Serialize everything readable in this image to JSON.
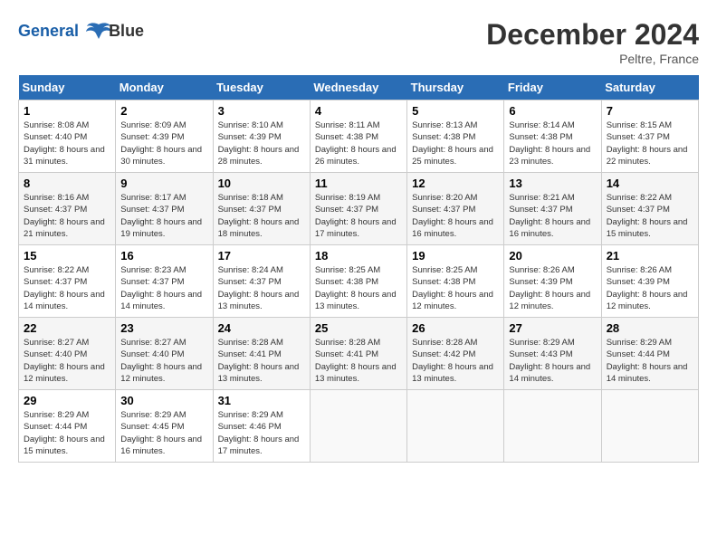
{
  "header": {
    "logo_line1": "General",
    "logo_line2": "Blue",
    "month": "December 2024",
    "location": "Peltre, France"
  },
  "days_of_week": [
    "Sunday",
    "Monday",
    "Tuesday",
    "Wednesday",
    "Thursday",
    "Friday",
    "Saturday"
  ],
  "weeks": [
    [
      {
        "day": "1",
        "sunrise": "8:08 AM",
        "sunset": "4:40 PM",
        "daylight": "8 hours and 31 minutes."
      },
      {
        "day": "2",
        "sunrise": "8:09 AM",
        "sunset": "4:39 PM",
        "daylight": "8 hours and 30 minutes."
      },
      {
        "day": "3",
        "sunrise": "8:10 AM",
        "sunset": "4:39 PM",
        "daylight": "8 hours and 28 minutes."
      },
      {
        "day": "4",
        "sunrise": "8:11 AM",
        "sunset": "4:38 PM",
        "daylight": "8 hours and 26 minutes."
      },
      {
        "day": "5",
        "sunrise": "8:13 AM",
        "sunset": "4:38 PM",
        "daylight": "8 hours and 25 minutes."
      },
      {
        "day": "6",
        "sunrise": "8:14 AM",
        "sunset": "4:38 PM",
        "daylight": "8 hours and 23 minutes."
      },
      {
        "day": "7",
        "sunrise": "8:15 AM",
        "sunset": "4:37 PM",
        "daylight": "8 hours and 22 minutes."
      }
    ],
    [
      {
        "day": "8",
        "sunrise": "8:16 AM",
        "sunset": "4:37 PM",
        "daylight": "8 hours and 21 minutes."
      },
      {
        "day": "9",
        "sunrise": "8:17 AM",
        "sunset": "4:37 PM",
        "daylight": "8 hours and 19 minutes."
      },
      {
        "day": "10",
        "sunrise": "8:18 AM",
        "sunset": "4:37 PM",
        "daylight": "8 hours and 18 minutes."
      },
      {
        "day": "11",
        "sunrise": "8:19 AM",
        "sunset": "4:37 PM",
        "daylight": "8 hours and 17 minutes."
      },
      {
        "day": "12",
        "sunrise": "8:20 AM",
        "sunset": "4:37 PM",
        "daylight": "8 hours and 16 minutes."
      },
      {
        "day": "13",
        "sunrise": "8:21 AM",
        "sunset": "4:37 PM",
        "daylight": "8 hours and 16 minutes."
      },
      {
        "day": "14",
        "sunrise": "8:22 AM",
        "sunset": "4:37 PM",
        "daylight": "8 hours and 15 minutes."
      }
    ],
    [
      {
        "day": "15",
        "sunrise": "8:22 AM",
        "sunset": "4:37 PM",
        "daylight": "8 hours and 14 minutes."
      },
      {
        "day": "16",
        "sunrise": "8:23 AM",
        "sunset": "4:37 PM",
        "daylight": "8 hours and 14 minutes."
      },
      {
        "day": "17",
        "sunrise": "8:24 AM",
        "sunset": "4:37 PM",
        "daylight": "8 hours and 13 minutes."
      },
      {
        "day": "18",
        "sunrise": "8:25 AM",
        "sunset": "4:38 PM",
        "daylight": "8 hours and 13 minutes."
      },
      {
        "day": "19",
        "sunrise": "8:25 AM",
        "sunset": "4:38 PM",
        "daylight": "8 hours and 12 minutes."
      },
      {
        "day": "20",
        "sunrise": "8:26 AM",
        "sunset": "4:39 PM",
        "daylight": "8 hours and 12 minutes."
      },
      {
        "day": "21",
        "sunrise": "8:26 AM",
        "sunset": "4:39 PM",
        "daylight": "8 hours and 12 minutes."
      }
    ],
    [
      {
        "day": "22",
        "sunrise": "8:27 AM",
        "sunset": "4:40 PM",
        "daylight": "8 hours and 12 minutes."
      },
      {
        "day": "23",
        "sunrise": "8:27 AM",
        "sunset": "4:40 PM",
        "daylight": "8 hours and 12 minutes."
      },
      {
        "day": "24",
        "sunrise": "8:28 AM",
        "sunset": "4:41 PM",
        "daylight": "8 hours and 13 minutes."
      },
      {
        "day": "25",
        "sunrise": "8:28 AM",
        "sunset": "4:41 PM",
        "daylight": "8 hours and 13 minutes."
      },
      {
        "day": "26",
        "sunrise": "8:28 AM",
        "sunset": "4:42 PM",
        "daylight": "8 hours and 13 minutes."
      },
      {
        "day": "27",
        "sunrise": "8:29 AM",
        "sunset": "4:43 PM",
        "daylight": "8 hours and 14 minutes."
      },
      {
        "day": "28",
        "sunrise": "8:29 AM",
        "sunset": "4:44 PM",
        "daylight": "8 hours and 14 minutes."
      }
    ],
    [
      {
        "day": "29",
        "sunrise": "8:29 AM",
        "sunset": "4:44 PM",
        "daylight": "8 hours and 15 minutes."
      },
      {
        "day": "30",
        "sunrise": "8:29 AM",
        "sunset": "4:45 PM",
        "daylight": "8 hours and 16 minutes."
      },
      {
        "day": "31",
        "sunrise": "8:29 AM",
        "sunset": "4:46 PM",
        "daylight": "8 hours and 17 minutes."
      },
      null,
      null,
      null,
      null
    ]
  ]
}
